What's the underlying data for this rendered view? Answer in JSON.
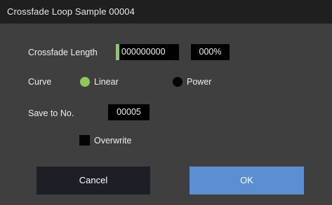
{
  "dialog": {
    "title": "Crossfade Loop Sample 00004"
  },
  "crossfade_length": {
    "label": "Crossfade Length",
    "value": "000000000",
    "percent": "000%"
  },
  "curve": {
    "label": "Curve",
    "options": [
      {
        "label": "Linear",
        "selected": true
      },
      {
        "label": "Power",
        "selected": false
      }
    ]
  },
  "save_to": {
    "label": "Save to No.",
    "value": "00005"
  },
  "overwrite": {
    "label": "Overwrite",
    "checked": false
  },
  "buttons": {
    "cancel": "Cancel",
    "ok": "OK"
  },
  "colors": {
    "accent": "#8fc95b",
    "ok_button": "#5c8fd1",
    "cancel_button": "#1e1f26",
    "panel": "#3f3f3f",
    "titlebar": "#1f1f1f"
  }
}
